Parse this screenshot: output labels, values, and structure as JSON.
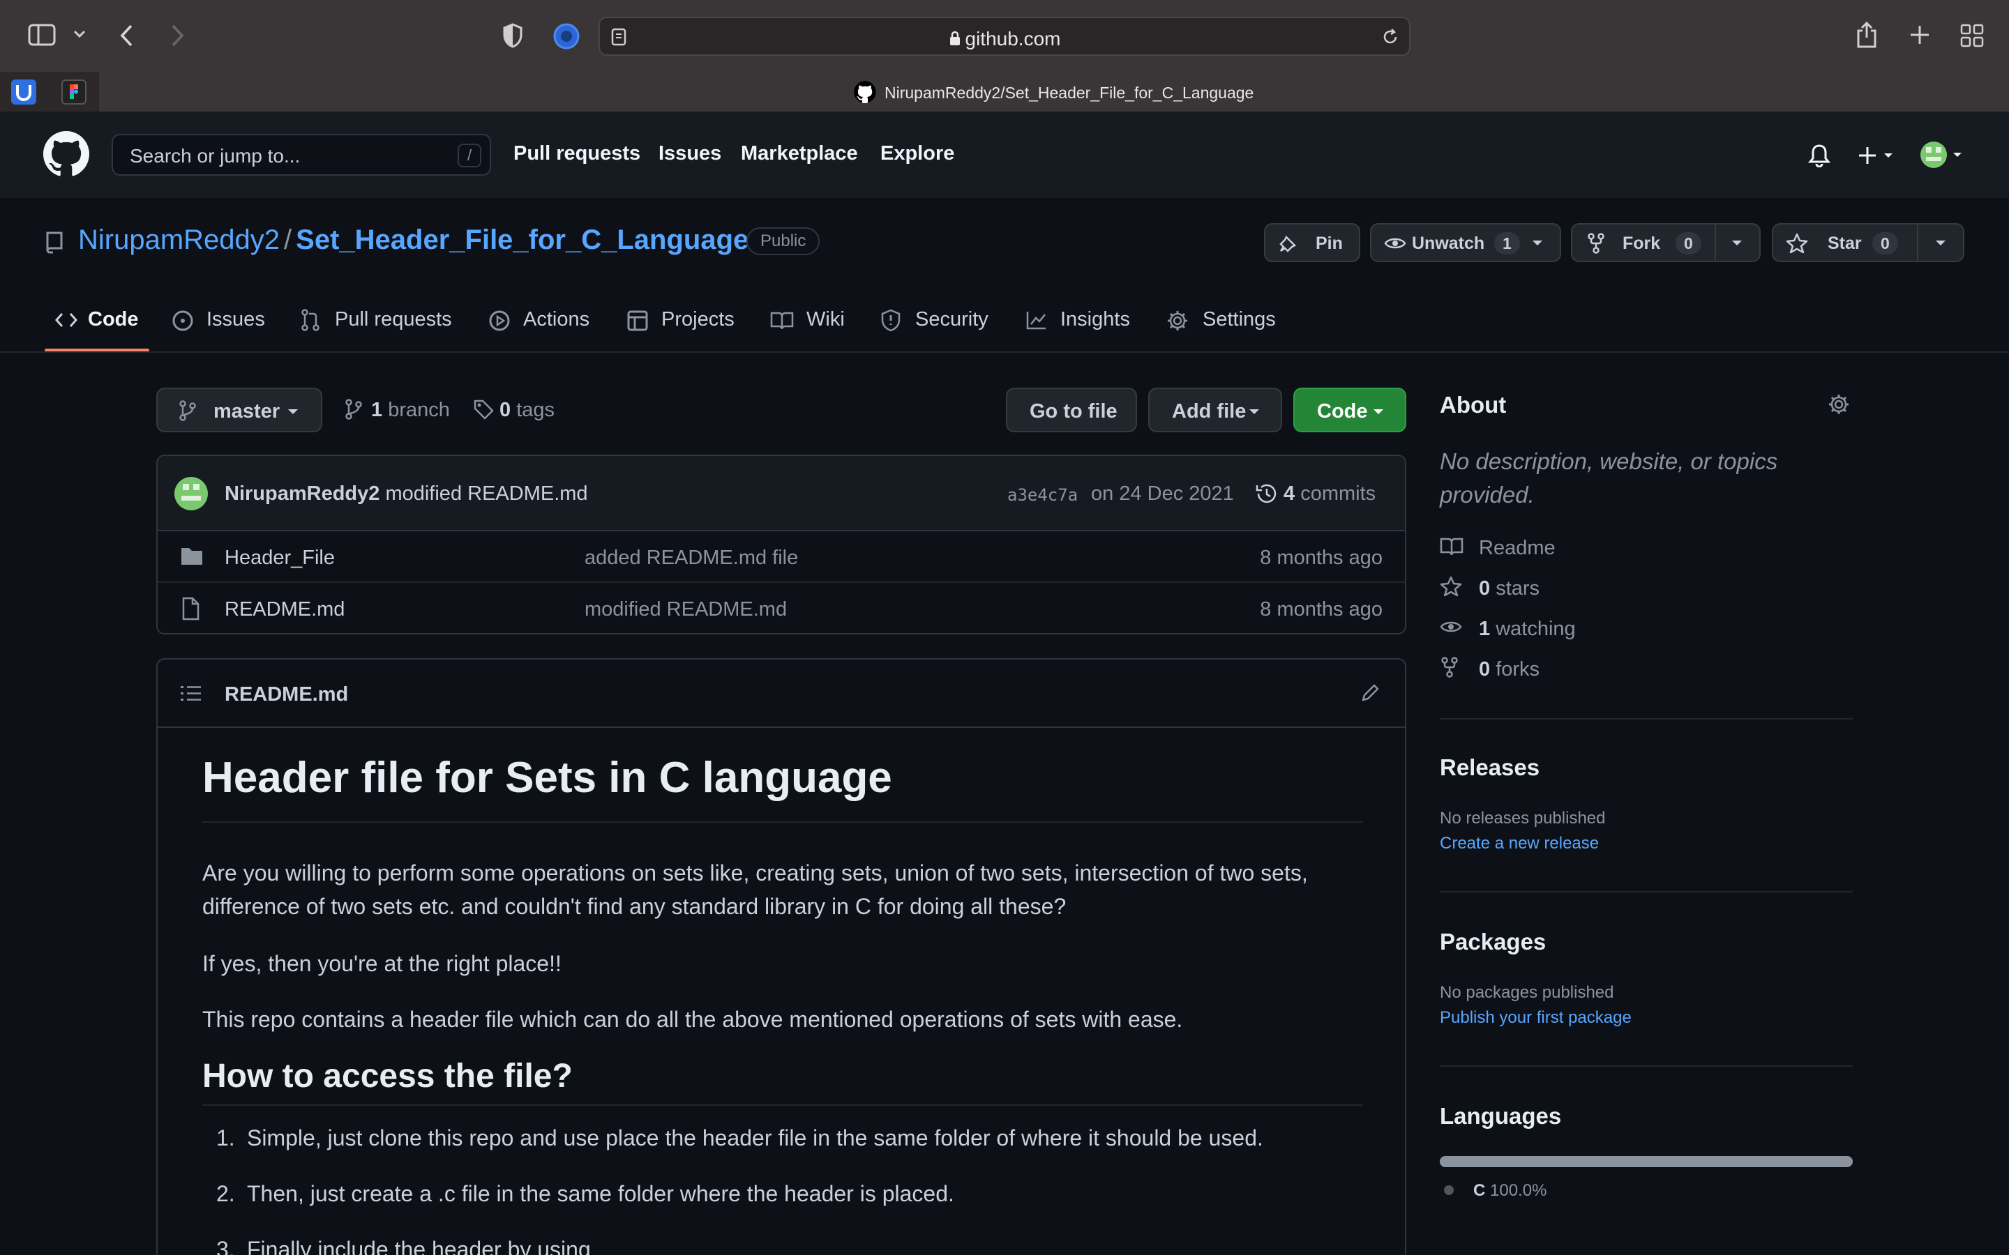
{
  "browser": {
    "address": "github.com",
    "tab_title": "NirupamReddy2/Set_Header_File_for_C_Language"
  },
  "header": {
    "search_placeholder": "Search or jump to...",
    "search_shortcut": "/",
    "nav": [
      "Pull requests",
      "Issues",
      "Marketplace",
      "Explore"
    ]
  },
  "repo": {
    "owner": "NirupamReddy2",
    "separator": "/",
    "name": "Set_Header_File_for_C_Language",
    "visibility": "Public",
    "pin_label": "Pin",
    "unwatch_label": "Unwatch",
    "watch_count": "1",
    "fork_label": "Fork",
    "fork_count": "0",
    "star_label": "Star",
    "star_count": "0"
  },
  "tabs": [
    "Code",
    "Issues",
    "Pull requests",
    "Actions",
    "Projects",
    "Wiki",
    "Security",
    "Insights",
    "Settings"
  ],
  "branch": {
    "current": "master",
    "branch_count": "1",
    "branch_word": "branch",
    "tag_count": "0",
    "tag_word": "tags",
    "goto_file": "Go to file",
    "add_file": "Add file",
    "code": "Code"
  },
  "commit": {
    "author": "NirupamReddy2",
    "message": "modified README.md",
    "sha": "a3e4c7a",
    "date": "on 24 Dec 2021",
    "commits_count": "4",
    "commits_word": "commits"
  },
  "files": [
    {
      "name": "Header_File",
      "message": "added README.md file",
      "age": "8 months ago",
      "type": "folder"
    },
    {
      "name": "README.md",
      "message": "modified README.md",
      "age": "8 months ago",
      "type": "file"
    }
  ],
  "readme": {
    "filename": "README.md",
    "h1": "Header file for Sets in C language",
    "p1a": "Are you willing to perform some operations on sets like, creating sets, union of two sets, intersection of two sets,",
    "p1b": "difference of two sets etc. and couldn't find any standard library in C for doing all these?",
    "p2": "If yes, then you're at the right place!!",
    "p3": "This repo contains a header file which can do all the above mentioned operations of sets with ease.",
    "h2": "How to access the file?",
    "steps": [
      {
        "n": "1.",
        "text": "Simple, just clone this repo and use place the header file in the same folder of where it should be used."
      },
      {
        "n": "2.",
        "text": "Then, just create a .c file in the same folder where the header is placed."
      },
      {
        "n": "3.",
        "text": "Finally include the header by using"
      }
    ]
  },
  "about": {
    "title": "About",
    "description": "No description, website, or topics provided.",
    "readme": "Readme",
    "stars_count": "0",
    "stars_word": "stars",
    "watching_count": "1",
    "watching_word": "watching",
    "forks_count": "0",
    "forks_word": "forks"
  },
  "releases": {
    "title": "Releases",
    "text": "No releases published",
    "link": "Create a new release"
  },
  "packages": {
    "title": "Packages",
    "text": "No packages published",
    "link": "Publish your first package"
  },
  "languages": {
    "title": "Languages",
    "name": "C",
    "percent": "100.0%",
    "color": "#555555",
    "share": 1.0
  },
  "colors": {
    "accent": "#58a6ff",
    "green": "#238636",
    "tab_underline": "#f78166"
  }
}
